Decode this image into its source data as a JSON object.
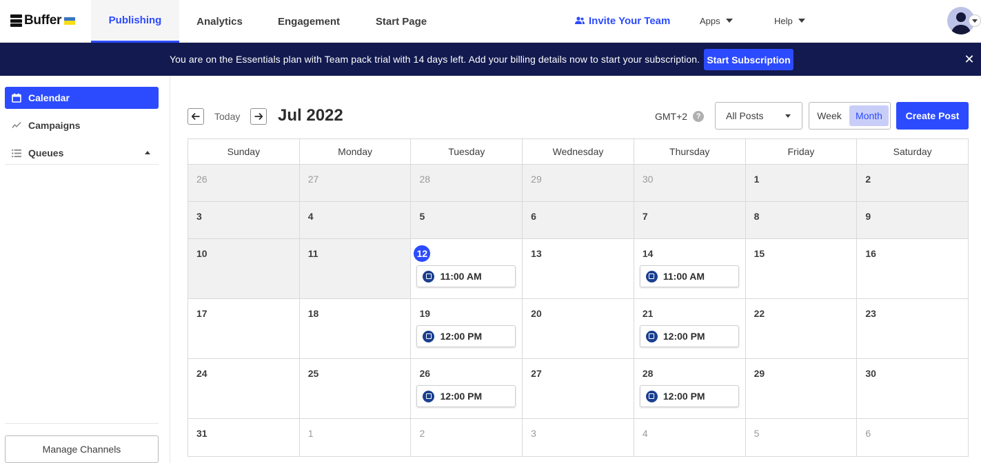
{
  "brand": {
    "name": "Buffer",
    "accent": "#2c4bff",
    "banner_bg": "#121a4f"
  },
  "nav": {
    "tabs": [
      {
        "label": "Publishing",
        "active": true
      },
      {
        "label": "Analytics",
        "active": false
      },
      {
        "label": "Engagement",
        "active": false
      },
      {
        "label": "Start Page",
        "active": false
      }
    ],
    "invite_label": "Invite Your Team",
    "apps_label": "Apps",
    "help_label": "Help"
  },
  "banner": {
    "text": "You are on the Essentials plan with Team pack trial with 14 days left. Add your billing details now to start your subscription.",
    "button_label": "Start Subscription",
    "close_icon": "close-icon"
  },
  "sidebar": {
    "items": [
      {
        "label": "Calendar",
        "icon": "calendar-icon",
        "active": true
      },
      {
        "label": "Campaigns",
        "icon": "trend-icon",
        "active": false
      },
      {
        "label": "Queues",
        "icon": "list-icon",
        "active": false
      }
    ],
    "manage_label": "Manage Channels"
  },
  "toolbar": {
    "today_label": "Today",
    "month_title": "Jul 2022",
    "timezone": "GMT+2",
    "filter_value": "All Posts",
    "week_label": "Week",
    "month_label": "Month",
    "create_label": "Create Post"
  },
  "calendar": {
    "weekdays": [
      "Sunday",
      "Monday",
      "Tuesday",
      "Wednesday",
      "Thursday",
      "Friday",
      "Saturday"
    ],
    "weeks": [
      [
        {
          "day": "26",
          "muted": true,
          "past": true,
          "posts": []
        },
        {
          "day": "27",
          "muted": true,
          "past": true,
          "posts": []
        },
        {
          "day": "28",
          "muted": true,
          "past": true,
          "posts": []
        },
        {
          "day": "29",
          "muted": true,
          "past": true,
          "posts": []
        },
        {
          "day": "30",
          "muted": true,
          "past": true,
          "posts": []
        },
        {
          "day": "1",
          "past": true,
          "posts": []
        },
        {
          "day": "2",
          "past": true,
          "posts": []
        }
      ],
      [
        {
          "day": "3",
          "past": true,
          "posts": []
        },
        {
          "day": "4",
          "past": true,
          "posts": []
        },
        {
          "day": "5",
          "past": true,
          "posts": []
        },
        {
          "day": "6",
          "past": true,
          "posts": []
        },
        {
          "day": "7",
          "past": true,
          "posts": []
        },
        {
          "day": "8",
          "past": true,
          "posts": []
        },
        {
          "day": "9",
          "past": true,
          "posts": []
        }
      ],
      [
        {
          "day": "10",
          "past": true,
          "posts": []
        },
        {
          "day": "11",
          "past": true,
          "posts": []
        },
        {
          "day": "12",
          "today": true,
          "posts": [
            "11:00 AM"
          ]
        },
        {
          "day": "13",
          "posts": []
        },
        {
          "day": "14",
          "posts": [
            "11:00 AM"
          ]
        },
        {
          "day": "15",
          "posts": []
        },
        {
          "day": "16",
          "posts": []
        }
      ],
      [
        {
          "day": "17",
          "posts": []
        },
        {
          "day": "18",
          "posts": []
        },
        {
          "day": "19",
          "posts": [
            "12:00 PM"
          ]
        },
        {
          "day": "20",
          "posts": []
        },
        {
          "day": "21",
          "posts": [
            "12:00 PM"
          ]
        },
        {
          "day": "22",
          "posts": []
        },
        {
          "day": "23",
          "posts": []
        }
      ],
      [
        {
          "day": "24",
          "posts": []
        },
        {
          "day": "25",
          "posts": []
        },
        {
          "day": "26",
          "posts": [
            "12:00 PM"
          ]
        },
        {
          "day": "27",
          "posts": []
        },
        {
          "day": "28",
          "posts": [
            "12:00 PM"
          ]
        },
        {
          "day": "29",
          "posts": []
        },
        {
          "day": "30",
          "posts": []
        }
      ],
      [
        {
          "day": "31",
          "posts": []
        },
        {
          "day": "1",
          "muted": true,
          "posts": []
        },
        {
          "day": "2",
          "muted": true,
          "posts": []
        },
        {
          "day": "3",
          "muted": true,
          "posts": []
        },
        {
          "day": "4",
          "muted": true,
          "posts": []
        },
        {
          "day": "5",
          "muted": true,
          "posts": []
        },
        {
          "day": "6",
          "muted": true,
          "posts": []
        }
      ]
    ]
  }
}
